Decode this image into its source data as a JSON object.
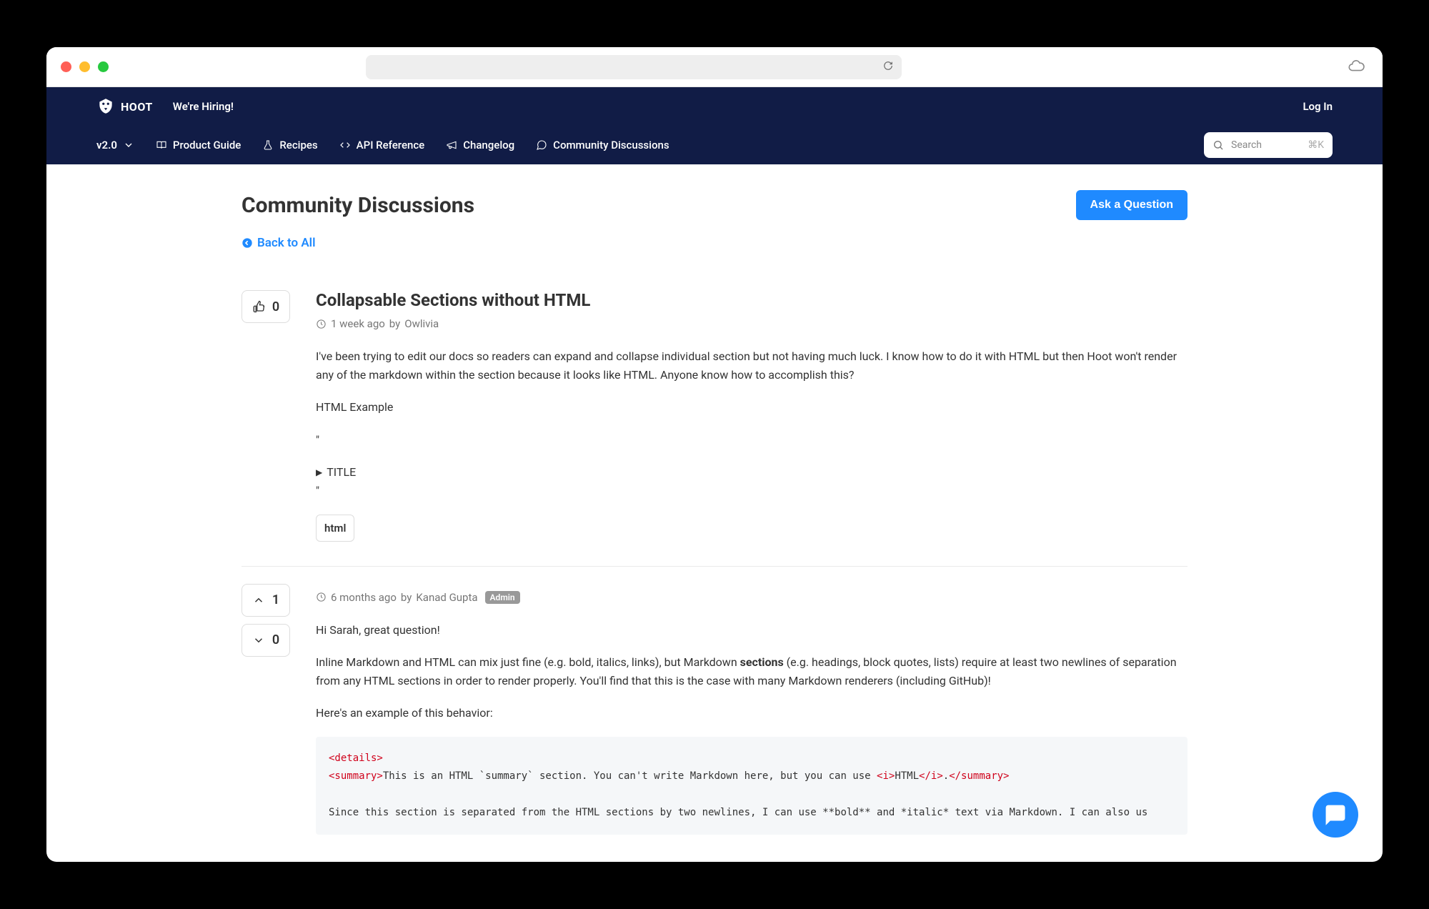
{
  "header": {
    "brand": "HOOT",
    "hiring": "We're Hiring!",
    "login": "Log In"
  },
  "subnav": {
    "version": "v2.0",
    "items": [
      {
        "label": "Product Guide"
      },
      {
        "label": "Recipes"
      },
      {
        "label": "API Reference"
      },
      {
        "label": "Changelog"
      },
      {
        "label": "Community Discussions"
      }
    ],
    "search_placeholder": "Search",
    "search_shortcut": "⌘K"
  },
  "page": {
    "title": "Community Discussions",
    "ask_label": "Ask a Question",
    "back_label": "Back to All"
  },
  "post": {
    "votes": "0",
    "title": "Collapsable Sections without HTML",
    "age": "1 week ago",
    "by": "by",
    "author": "Owlivia",
    "body_p1": "I've been trying to edit our docs so readers can expand and collapse individual section but not having much luck. I know how to do it with HTML but then Hoot won't render any of the markdown within the section because it looks like HTML. Anyone know how to accomplish this?",
    "body_p2": "HTML Example",
    "quote_open": "\"",
    "disclosure_title": "TITLE",
    "quote_close": "\"",
    "tag": "html"
  },
  "reply": {
    "up": "1",
    "down": "0",
    "age": "6 months ago",
    "by": "by",
    "author": "Kanad Gupta",
    "badge": "Admin",
    "p1": "Hi Sarah, great question!",
    "p2a": "Inline Markdown and HTML can mix just fine (e.g. bold, italics, links), but Markdown ",
    "p2_strong": "sections",
    "p2b": " (e.g. headings, block quotes, lists) require at least two newlines of separation from any HTML sections in order to render properly. You'll find that this is the case with many Markdown renderers (including GitHub)!",
    "p3": "Here's an example of this behavior:",
    "code": {
      "l1": "<details>",
      "l2a": "<summary>",
      "l2b": "This is an HTML `summary` section. You can't write Markdown here, but you can use ",
      "l2c": "<i>",
      "l2d": "HTML",
      "l2e": "</i>",
      "l2f": ".",
      "l2g": "</summary>",
      "l3": "Since this section is separated from the HTML sections by two newlines, I can use **bold** and *italic* text via Markdown. I can also us"
    }
  }
}
